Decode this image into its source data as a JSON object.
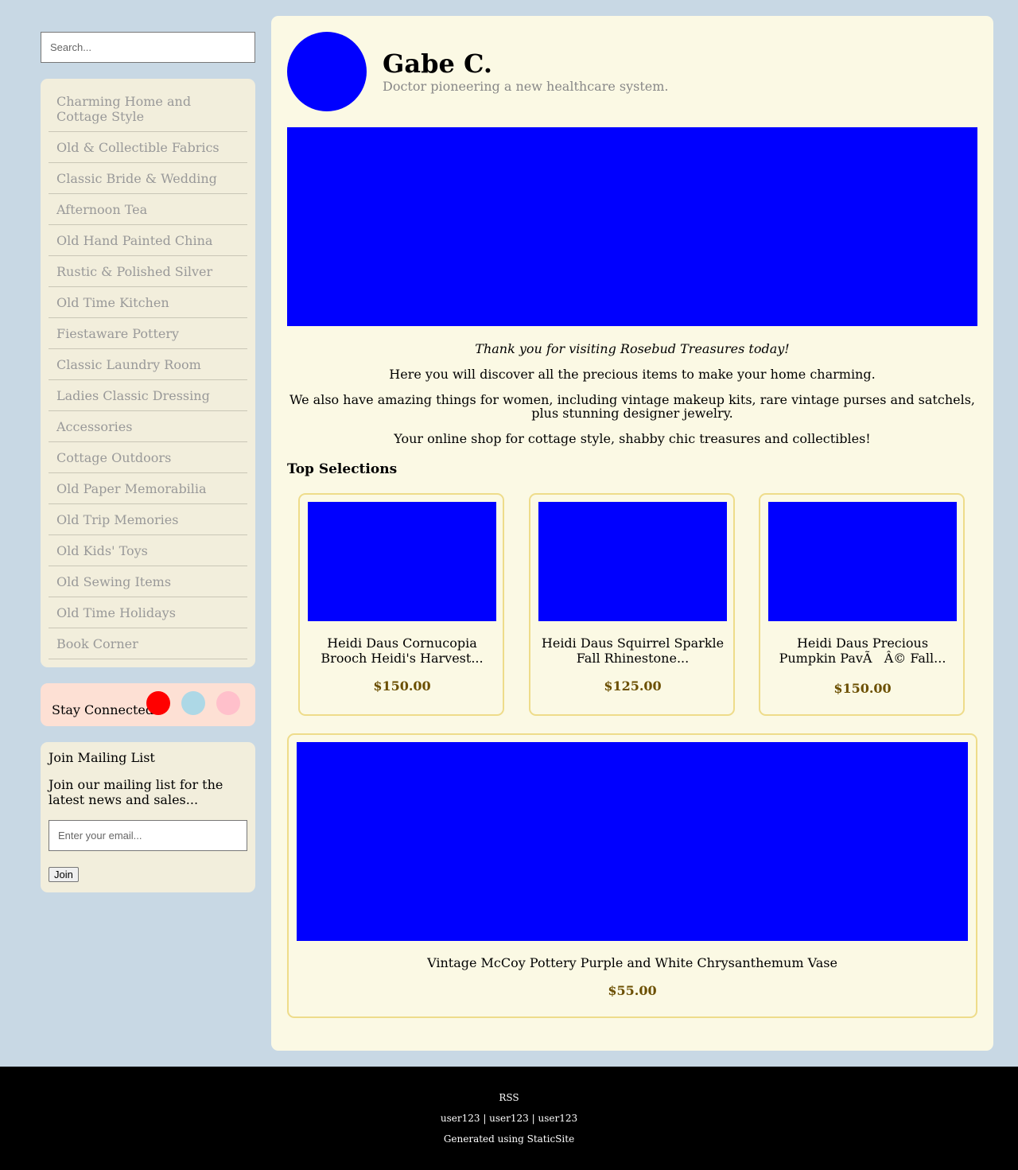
{
  "search": {
    "placeholder": "Search..."
  },
  "categories": [
    "Charming Home and Cottage Style",
    "Old & Collectible Fabrics",
    "Classic Bride & Wedding",
    "Afternoon Tea",
    "Old Hand Painted China",
    "Rustic & Polished Silver",
    "Old Time Kitchen",
    "Fiestaware Pottery",
    "Classic Laundry Room",
    "Ladies Classic Dressing",
    "Accessories",
    "Cottage Outdoors",
    "Old Paper Memorabilia",
    "Old Trip Memories",
    "Old Kids' Toys",
    "Old Sewing Items",
    "Old Time Holidays",
    "Book Corner"
  ],
  "social": {
    "label": "Stay Connected",
    "colors": [
      "#ff0000",
      "#add8e6",
      "#ffc0cb"
    ]
  },
  "mailing": {
    "title": "Join Mailing List",
    "text": "Join our mailing list for the latest news and sales...",
    "placeholder": "Enter your email...",
    "button": "Join"
  },
  "profile": {
    "name": "Gabe C.",
    "tagline": "Doctor pioneering a new healthcare system."
  },
  "intro": {
    "thanks": "Thank you for visiting Rosebud Treasures today!",
    "line1": "Here you will discover all the precious items to make your home charming.",
    "line2": "We also have amazing things for women, including vintage makeup kits, rare vintage purses and satchels, plus stunning designer jewelry.",
    "line3": "Your online shop for cottage style, shabby chic treasures and collectibles!"
  },
  "selections": {
    "title": "Top Selections",
    "products": [
      {
        "title": "Heidi Daus Cornucopia Brooch Heidi's Harvest...",
        "price": "$150.00"
      },
      {
        "title": "Heidi Daus Squirrel Sparkle Fall Rhinestone...",
        "price": "$125.00"
      },
      {
        "title": "Heidi Daus Precious Pumpkin PavÃ   Â© Fall...",
        "price": "$150.00"
      }
    ],
    "featured": {
      "title": "Vintage McCoy Pottery Purple and White Chrysanthemum Vase",
      "price": "$55.00"
    }
  },
  "footer": {
    "rss": "RSS",
    "users": [
      "user123",
      "user123",
      "user123"
    ],
    "separator": " | ",
    "generated": "Generated using StaticSite"
  },
  "colors": {
    "background": "#c8d8e4",
    "panel": "#fbf9e4",
    "sidebar_box": "#f2eedc",
    "social_box": "#fde0d4",
    "placeholder_image": "#0000ff",
    "price": "#6b4f00",
    "card_border": "#eedc8a"
  }
}
